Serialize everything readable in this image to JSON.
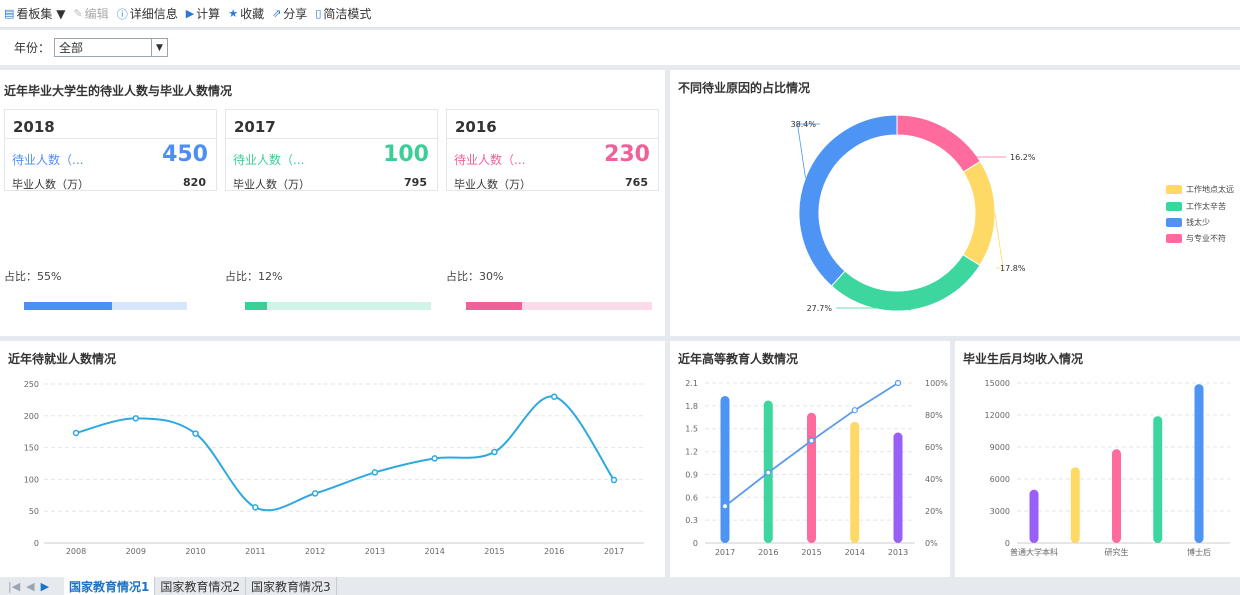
{
  "toolbar": {
    "items": [
      {
        "label": "看板集 ▼",
        "icon": "board-icon",
        "disabled": false
      },
      {
        "label": "编辑",
        "icon": "pencil-icon",
        "disabled": true
      },
      {
        "label": "详细信息",
        "icon": "info-icon",
        "disabled": false
      },
      {
        "label": "计算",
        "icon": "play-icon",
        "disabled": false
      },
      {
        "label": "收藏",
        "icon": "star-icon",
        "disabled": false
      },
      {
        "label": "分享",
        "icon": "share-icon",
        "disabled": false
      },
      {
        "label": "简洁模式",
        "icon": "doc-icon",
        "disabled": false
      }
    ]
  },
  "filter": {
    "label": "年份：",
    "value": "全部"
  },
  "summary": {
    "title": "近年毕业大学生的待业人数与毕业人数情况",
    "cards": [
      {
        "year": "2018",
        "unemployed_label": "待业人数（...",
        "unemployed_value": "450",
        "grad_label": "毕业人数（万）",
        "grad_value": "820",
        "ratio_label": "占比：55%",
        "ratio": 0.55,
        "color": "#4e8ff5",
        "light": "#d8e6fd"
      },
      {
        "year": "2017",
        "unemployed_label": "待业人数（...",
        "unemployed_value": "100",
        "grad_label": "毕业人数（万）",
        "grad_value": "795",
        "ratio_label": "占比：12%",
        "ratio": 0.12,
        "color": "#3acf96",
        "light": "#d2f4e8"
      },
      {
        "year": "2016",
        "unemployed_label": "待业人数（...",
        "unemployed_value": "230",
        "grad_label": "毕业人数（万）",
        "grad_value": "765",
        "ratio_label": "占比：30%",
        "ratio": 0.3,
        "color": "#f0609a",
        "light": "#fcdbe8"
      }
    ]
  },
  "donut": {
    "title": "不同待业原因的占比情况",
    "chart_data": {
      "type": "pie",
      "slices": [
        {
          "name": "与专业不符",
          "value": 16.2,
          "label": "16.2%",
          "color": "#ff6b9d"
        },
        {
          "name": "工作地点太远",
          "value": 17.8,
          "label": "17.8%",
          "color": "#ffd966"
        },
        {
          "name": "工作太辛苦",
          "value": 27.7,
          "label": "27.7%",
          "color": "#3dd69e"
        },
        {
          "name": "钱太少",
          "value": 38.4,
          "label": "38.4%",
          "color": "#4e94f5"
        }
      ],
      "legend": [
        "工作地点太远",
        "工作太辛苦",
        "钱太少",
        "与专业不符"
      ],
      "legend_colors": [
        "#ffd966",
        "#3dd69e",
        "#4e94f5",
        "#ff6b9d"
      ],
      "legend_position": "right"
    }
  },
  "line_panel": {
    "title": "近年待就业人数情况",
    "chart_data": {
      "type": "line",
      "x": [
        "2008",
        "2009",
        "2010",
        "2011",
        "2012",
        "2013",
        "2014",
        "2015",
        "2016",
        "2017"
      ],
      "values": [
        173,
        196,
        172,
        56,
        78,
        111,
        133,
        143,
        230,
        99
      ],
      "ylim": [
        0,
        250
      ],
      "yticks": [
        "0",
        "50",
        "100",
        "150",
        "200",
        "250"
      ],
      "color": "#2ea9e0",
      "grid": true
    }
  },
  "edu_panel": {
    "title": "近年高等教育人数情况",
    "chart_data": {
      "type": "bar",
      "categories": [
        "2017",
        "2016",
        "2015",
        "2014",
        "2013"
      ],
      "values": [
        1.93,
        1.87,
        1.71,
        1.59,
        1.45
      ],
      "bar_colors": [
        "#4e94f5",
        "#3dd69e",
        "#ff6b9d",
        "#ffd966",
        "#9a5ff5"
      ],
      "ylim": [
        0,
        2.1
      ],
      "yticks": [
        "0",
        "0.3",
        "0.6",
        "0.9",
        "1.2",
        "1.5",
        "1.8",
        "2.1"
      ],
      "line_values": [
        23,
        44,
        64,
        83,
        100
      ],
      "y2lim": [
        0,
        100
      ],
      "y2ticks": [
        "0%",
        "20%",
        "40%",
        "60%",
        "80%",
        "100%"
      ],
      "line_color": "#5b9bec",
      "grid": true
    }
  },
  "income_panel": {
    "title": "毕业生后月均收入情况",
    "chart_data": {
      "type": "bar",
      "categories": [
        "普通大学本科",
        "",
        "研究生",
        "",
        "博士后"
      ],
      "values": [
        5000,
        7100,
        8800,
        11900,
        14900
      ],
      "bar_colors": [
        "#9a5ff5",
        "#ffd966",
        "#ff6b9d",
        "#3dd69e",
        "#4e94f5"
      ],
      "ylim": [
        0,
        15000
      ],
      "yticks": [
        "0",
        "3000",
        "6000",
        "9000",
        "12000",
        "15000"
      ],
      "grid": true
    }
  },
  "tabs": {
    "items": [
      "国家教育情况1",
      "国家教育情况2",
      "国家教育情况3"
    ],
    "active": 0
  }
}
